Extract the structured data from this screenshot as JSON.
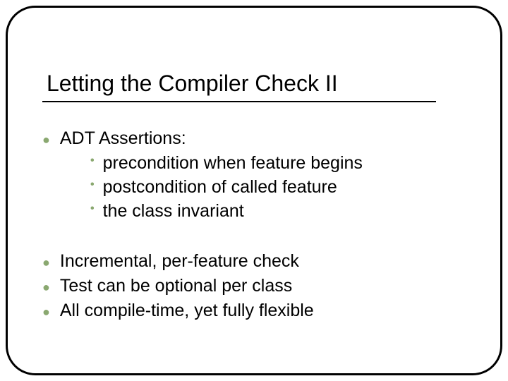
{
  "slide": {
    "title": "Letting the Compiler Check II",
    "bullets": {
      "b1": "ADT Assertions:",
      "b1_subs": {
        "s1": "precondition when feature begins",
        "s2": "postcondition of called feature",
        "s3": "the class invariant"
      },
      "b2": "Incremental, per-feature check",
      "b3": "Test can be optional per class",
      "b4": "All compile-time, yet fully flexible"
    }
  }
}
